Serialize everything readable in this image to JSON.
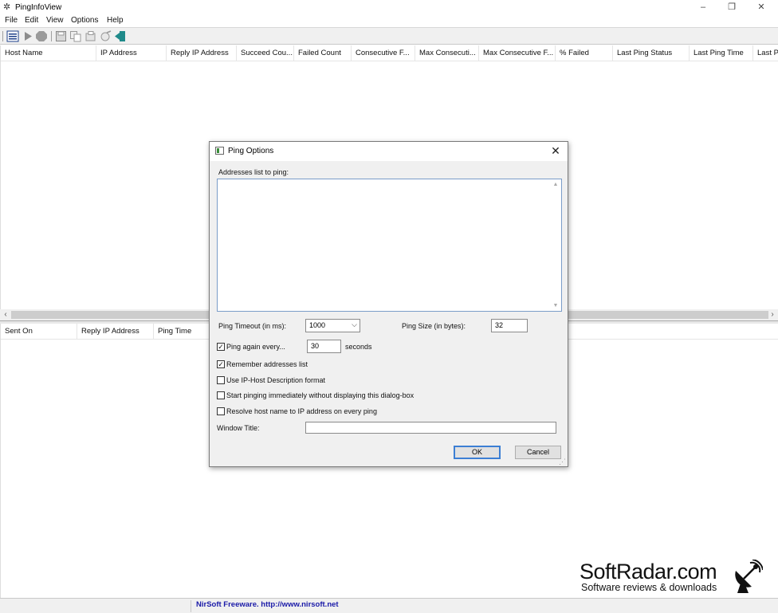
{
  "window": {
    "title": "PingInfoView",
    "icon": "network-tools-icon"
  },
  "menu": [
    "File",
    "Edit",
    "View",
    "Options",
    "Help"
  ],
  "toolbar": [
    "properties-icon",
    "start-icon",
    "stop-icon",
    "save-icon",
    "copy-icon",
    "html-report-icon",
    "ping-icon",
    "exit-icon"
  ],
  "top_columns": [
    "Host Name",
    "IP Address",
    "Reply IP Address",
    "Succeed Cou...",
    "Failed Count",
    "Consecutive F...",
    "Max Consecuti...",
    "Max Consecutive F...",
    "% Failed",
    "Last Ping Status",
    "Last Ping Time",
    "Last P"
  ],
  "bottom_columns": [
    "Sent On",
    "Reply IP Address",
    "Ping Time"
  ],
  "status": {
    "text": "NirSoft Freeware.  http://www.nirsoft.net"
  },
  "dialog": {
    "title": "Ping Options",
    "addresses_label": "Addresses list to ping:",
    "timeout_label": "Ping Timeout (in ms):",
    "timeout_value": "1000",
    "size_label": "Ping Size (in bytes):",
    "size_value": "32",
    "ping_again_label": "Ping again every...",
    "ping_again_value": "30",
    "seconds_label": "seconds",
    "remember_label": "Remember addresses list",
    "iphost_label": "Use IP-Host Description format",
    "start_label": "Start pinging immediately without displaying this dialog-box",
    "resolve_label": "Resolve host name to IP address on every ping",
    "window_title_label": "Window Title:",
    "window_title_value": "",
    "ok_label": "OK",
    "cancel_label": "Cancel",
    "checks": {
      "ping_again": true,
      "remember": true,
      "iphost": false,
      "start": false,
      "resolve": false
    }
  },
  "watermark": {
    "name": "SoftRadar.com",
    "tagline": "Software reviews & downloads"
  }
}
